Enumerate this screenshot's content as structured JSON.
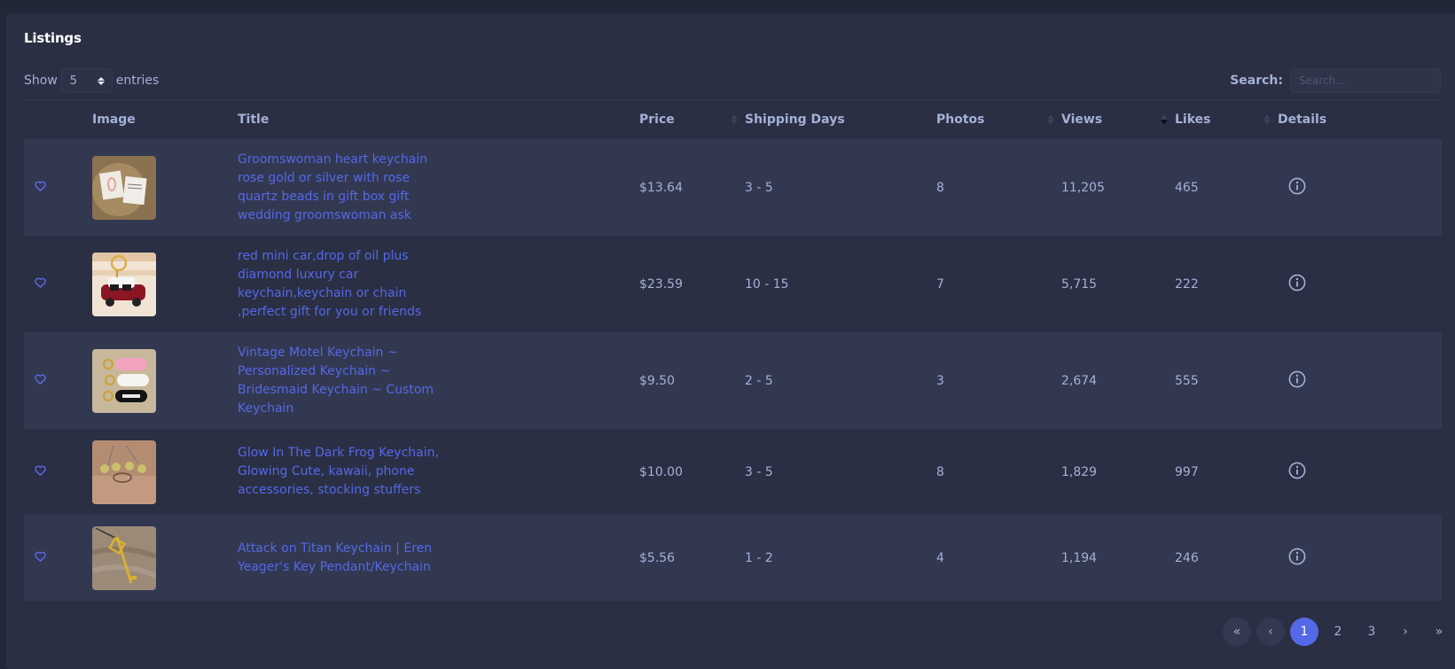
{
  "card": {
    "title": "Listings"
  },
  "length_menu": {
    "show_label": "Show",
    "value": "5",
    "entries_label": "entries"
  },
  "search": {
    "label": "Search:",
    "placeholder": "Search...",
    "value": ""
  },
  "table": {
    "columns": [
      {
        "key": "fav",
        "label": "",
        "sortable": false
      },
      {
        "key": "image",
        "label": "Image",
        "sortable": false
      },
      {
        "key": "title",
        "label": "Title",
        "sortable": false
      },
      {
        "key": "price",
        "label": "Price",
        "sortable": true,
        "sort": "none"
      },
      {
        "key": "shipping",
        "label": "Shipping Days",
        "sortable": false
      },
      {
        "key": "photos",
        "label": "Photos",
        "sortable": true,
        "sort": "none"
      },
      {
        "key": "views",
        "label": "Views",
        "sortable": true,
        "sort": "desc"
      },
      {
        "key": "likes",
        "label": "Likes",
        "sortable": true,
        "sort": "none"
      },
      {
        "key": "details",
        "label": "Details",
        "sortable": false
      }
    ],
    "rows": [
      {
        "favorite_icon": "heart-outline-icon",
        "image_alt": "Rose gold heart keychain in gift box",
        "title": "Groomswoman heart keychain rose gold or silver with rose quartz beads in gift box gift wedding groomswoman ask",
        "price": "$13.64",
        "shipping": "3 - 5",
        "photos": "8",
        "views": "11,205",
        "likes": "465",
        "details_icon": "info-circle-icon"
      },
      {
        "favorite_icon": "heart-outline-icon",
        "image_alt": "Red mini car keychain",
        "title": "red mini car,drop of oil plus diamond luxury car keychain,keychain or chain ,perfect gift for you or friends",
        "price": "$23.59",
        "shipping": "10 - 15",
        "photos": "7",
        "views": "5,715",
        "likes": "222",
        "details_icon": "info-circle-icon"
      },
      {
        "favorite_icon": "heart-outline-icon",
        "image_alt": "Vintage motel keychains personalized",
        "title": "Vintage Motel Keychain ~ Personalized Keychain ~ Bridesmaid Keychain ~ Custom Keychain",
        "price": "$9.50",
        "shipping": "2 - 5",
        "photos": "3",
        "views": "2,674",
        "likes": "555",
        "details_icon": "info-circle-icon"
      },
      {
        "favorite_icon": "heart-outline-icon",
        "image_alt": "Glow in the dark frog keychains",
        "title": "Glow In The Dark Frog Keychain, Glowing Cute, kawaii, phone accessories, stocking stuffers",
        "price": "$10.00",
        "shipping": "3 - 5",
        "photos": "8",
        "views": "1,829",
        "likes": "997",
        "details_icon": "info-circle-icon"
      },
      {
        "favorite_icon": "heart-outline-icon",
        "image_alt": "Attack on Titan key pendant",
        "title": "Attack on Titan Keychain | Eren Yeager's Key Pendant/Keychain",
        "price": "$5.56",
        "shipping": "1 - 2",
        "photos": "4",
        "views": "1,194",
        "likes": "246",
        "details_icon": "info-circle-icon"
      }
    ]
  },
  "pagination": {
    "first": "«",
    "prev": "‹",
    "next": "›",
    "last": "»",
    "pages": [
      "1",
      "2",
      "3"
    ],
    "current": "1"
  },
  "colors": {
    "accent": "#5469e8",
    "link": "#5468e8",
    "text_muted": "#a4b0d6",
    "card_bg": "#2a2f43",
    "row_alt_bg": "#323850",
    "page_bg": "#222738"
  }
}
